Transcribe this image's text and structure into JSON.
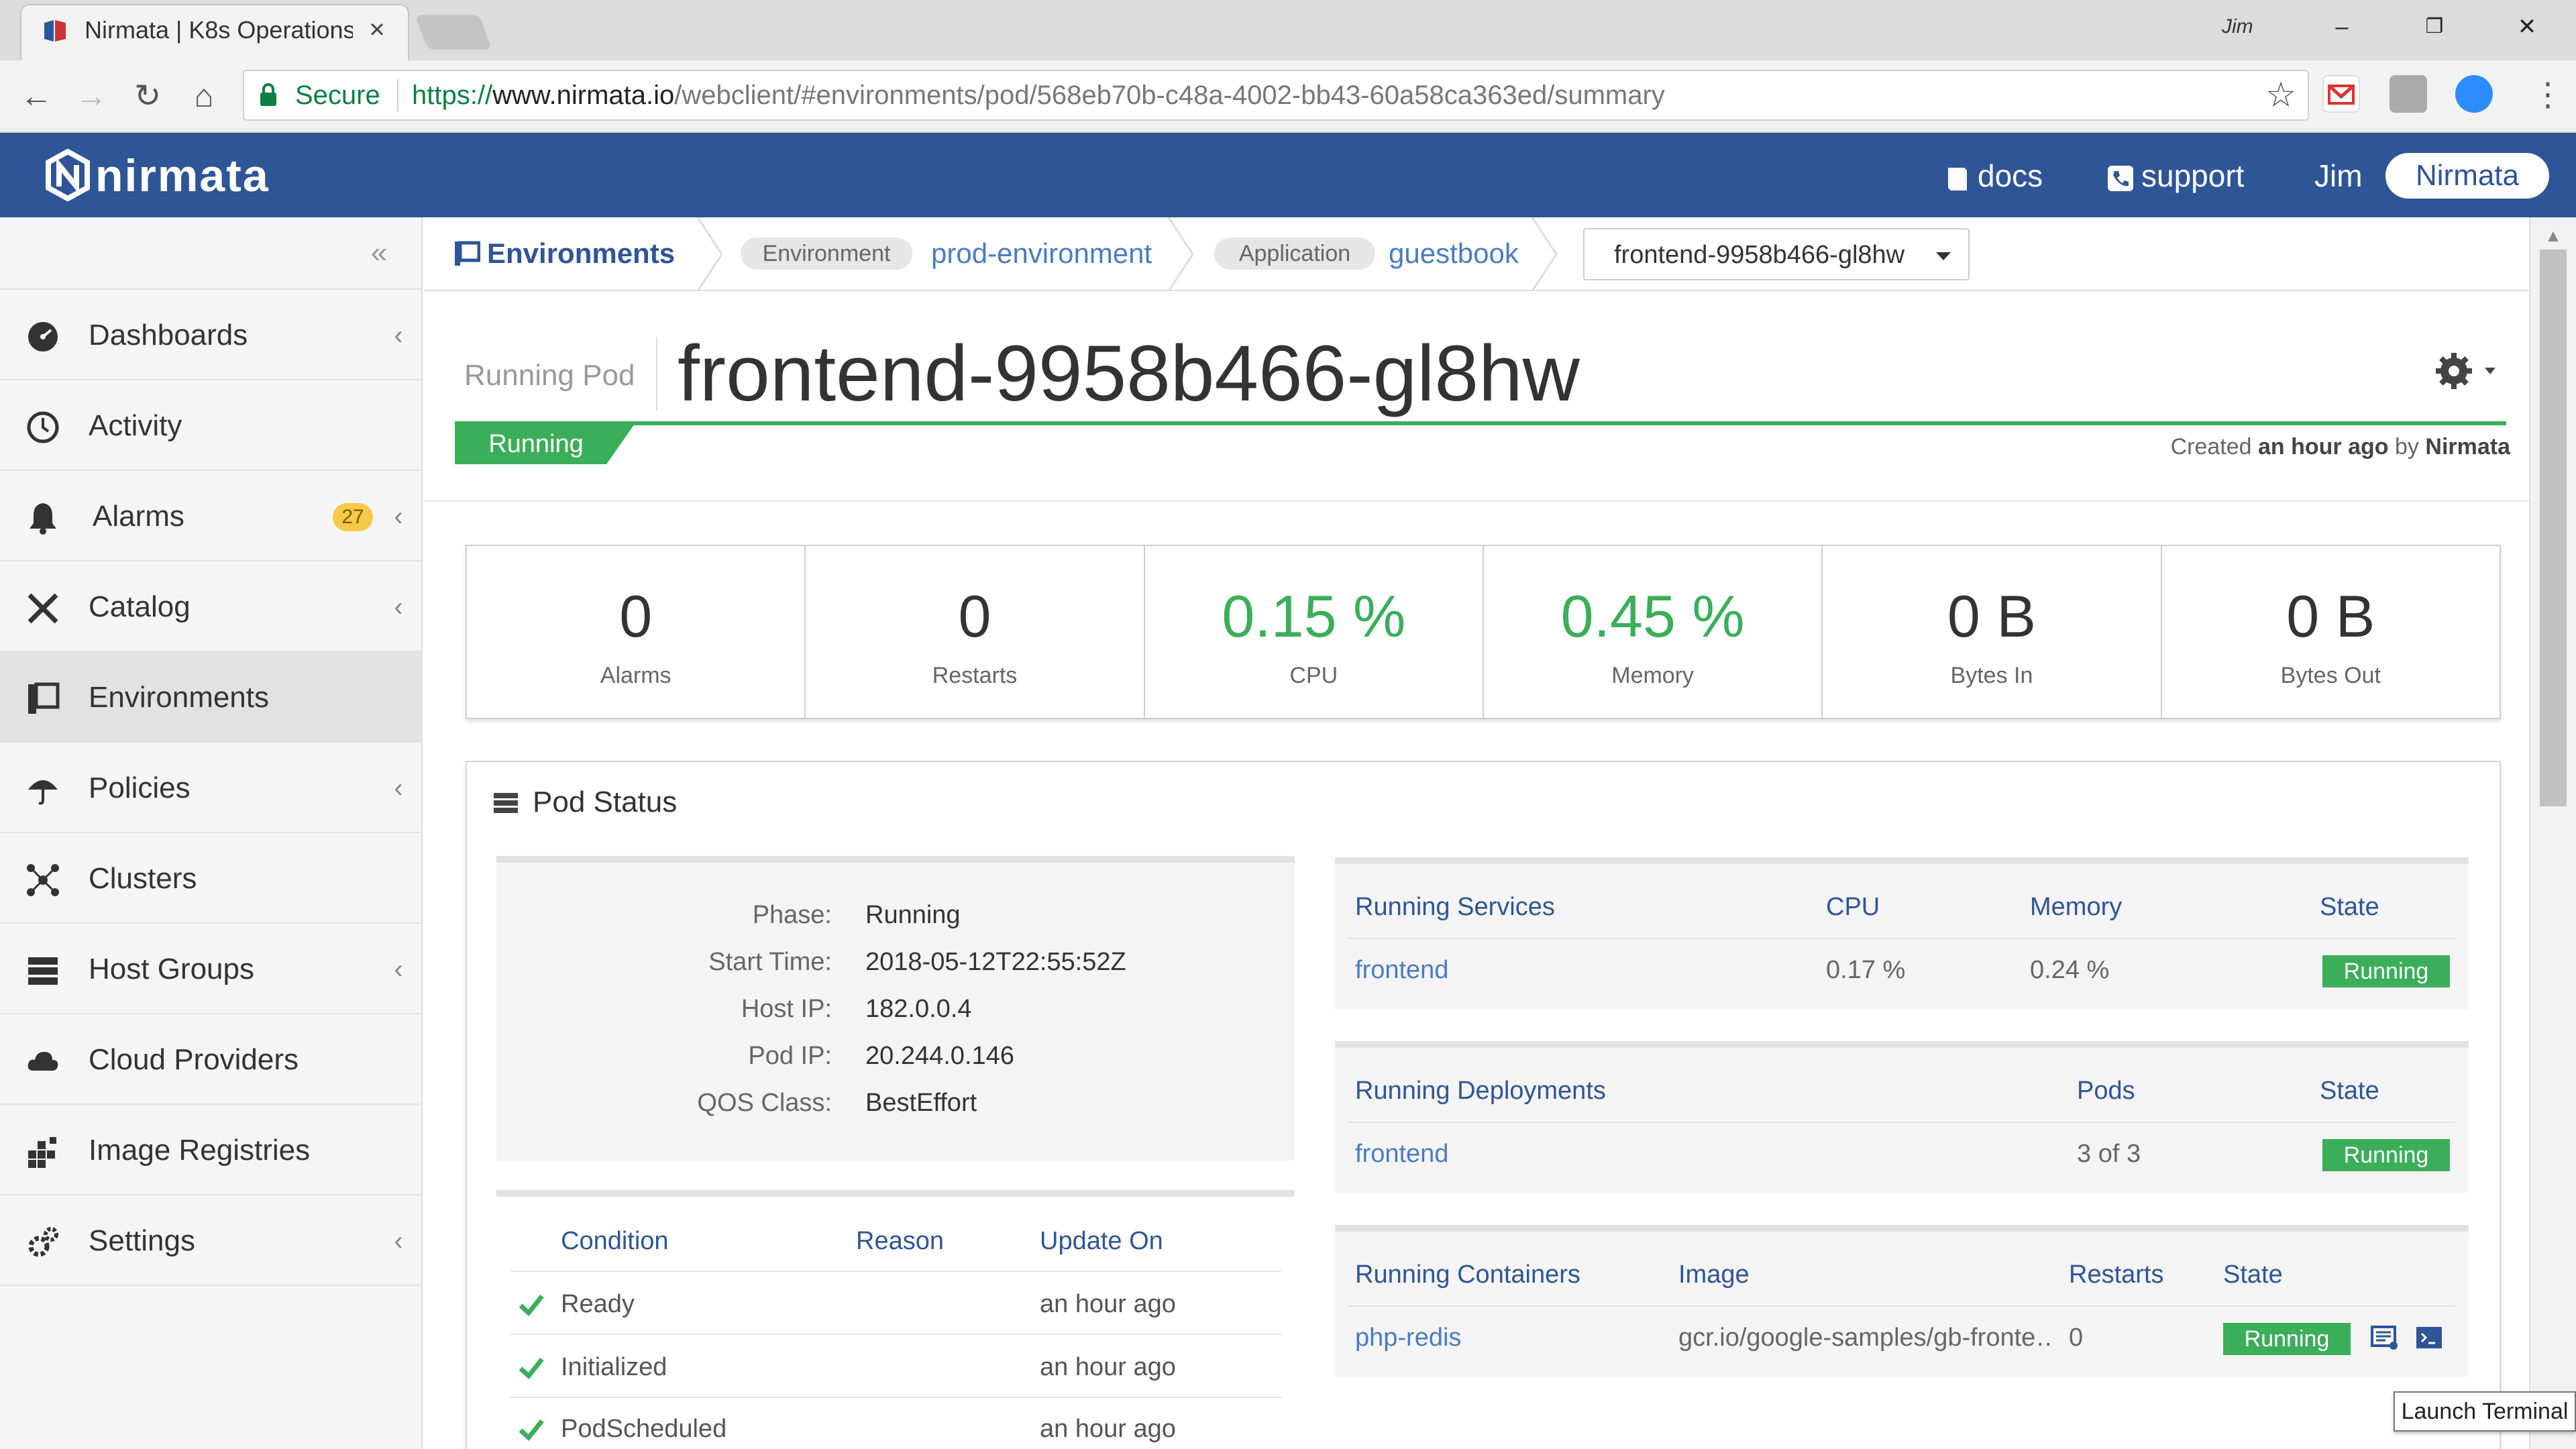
{
  "browser": {
    "tab_title": "Nirmata | K8s Operations",
    "tab_close": "×",
    "window_user": "Jim",
    "window_min": "–",
    "window_restore": "❐",
    "window_close": "✕",
    "secure_label": "Secure",
    "url_scheme": "https://",
    "url_host": "www.nirmata.io",
    "url_path": "/webclient/#environments/pod/568eb70b-c48a-4002-bb43-60a58ca363ed/summary"
  },
  "header": {
    "logo_text": "nirmata",
    "docs_label": "docs",
    "support_label": "support",
    "user_name": "Jim",
    "tenant_label": "Nirmata",
    "color": "#2e5596"
  },
  "sidebar": {
    "items": [
      {
        "label": "Dashboards",
        "icon": "dashboard-icon"
      },
      {
        "label": "Activity",
        "icon": "activity-icon"
      },
      {
        "label": "Alarms",
        "icon": "bell-icon",
        "badge": "27"
      },
      {
        "label": "Catalog",
        "icon": "catalog-icon"
      },
      {
        "label": "Environments",
        "icon": "environments-icon",
        "active": true
      },
      {
        "label": "Policies",
        "icon": "umbrella-icon"
      },
      {
        "label": "Clusters",
        "icon": "clusters-icon"
      },
      {
        "label": "Host Groups",
        "icon": "host-groups-icon"
      },
      {
        "label": "Cloud Providers",
        "icon": "cloud-icon"
      },
      {
        "label": "Image Registries",
        "icon": "registries-icon"
      },
      {
        "label": "Settings",
        "icon": "settings-icon"
      }
    ]
  },
  "breadcrumb": {
    "root": "Environments",
    "env_pill": "Environment",
    "env_value": "prod-environment",
    "app_pill": "Application",
    "app_value": "guestbook",
    "pod_select_value": "frontend-9958b466-gl8hw"
  },
  "pod": {
    "kind": "Running Pod",
    "name": "frontend-9958b466-gl8hw",
    "status": "Running",
    "created_prefix": "Created",
    "created_when": "an hour ago",
    "created_by_word": "by",
    "created_by": "Nirmata"
  },
  "stats": [
    {
      "value": "0",
      "label": "Alarms",
      "green": false
    },
    {
      "value": "0",
      "label": "Restarts",
      "green": false
    },
    {
      "value": "0.15 %",
      "label": "CPU",
      "green": true
    },
    {
      "value": "0.45 %",
      "label": "Memory",
      "green": true
    },
    {
      "value": "0 B",
      "label": "Bytes In",
      "green": false
    },
    {
      "value": "0 B",
      "label": "Bytes Out",
      "green": false
    }
  ],
  "pod_status": {
    "title": "Pod Status",
    "info": [
      {
        "key": "Phase:",
        "value": "Running"
      },
      {
        "key": "Start Time:",
        "value": "2018-05-12T22:55:52Z"
      },
      {
        "key": "Host IP:",
        "value": "182.0.0.4"
      },
      {
        "key": "Pod IP:",
        "value": "20.244.0.146"
      },
      {
        "key": "QOS Class:",
        "value": "BestEffort"
      }
    ],
    "conditions": {
      "headers": [
        "Condition",
        "Reason",
        "Update On"
      ],
      "rows": [
        {
          "name": "Ready",
          "reason": "",
          "time": "an hour ago"
        },
        {
          "name": "Initialized",
          "reason": "",
          "time": "an hour ago"
        },
        {
          "name": "PodScheduled",
          "reason": "",
          "time": "an hour ago"
        }
      ]
    },
    "services": {
      "headers": [
        "Running Services",
        "CPU",
        "Memory",
        "State"
      ],
      "rows": [
        {
          "name": "frontend",
          "cpu": "0.17 %",
          "memory": "0.24 %",
          "state": "Running"
        }
      ]
    },
    "deployments": {
      "headers": [
        "Running Deployments",
        "Pods",
        "State"
      ],
      "rows": [
        {
          "name": "frontend",
          "pods": "3 of 3",
          "state": "Running"
        }
      ]
    },
    "containers": {
      "headers": [
        "Running Containers",
        "Image",
        "Restarts",
        "State"
      ],
      "rows": [
        {
          "name": "php-redis",
          "image": "gcr.io/google-samples/gb-fronte…",
          "restarts": "0",
          "state": "Running"
        }
      ]
    }
  },
  "tooltip": "Launch Terminal",
  "colors": {
    "green": "#3bae5a",
    "link": "#4a7cc0",
    "header_blue": "#2e5596",
    "badge_yellow": "#f7c948"
  }
}
